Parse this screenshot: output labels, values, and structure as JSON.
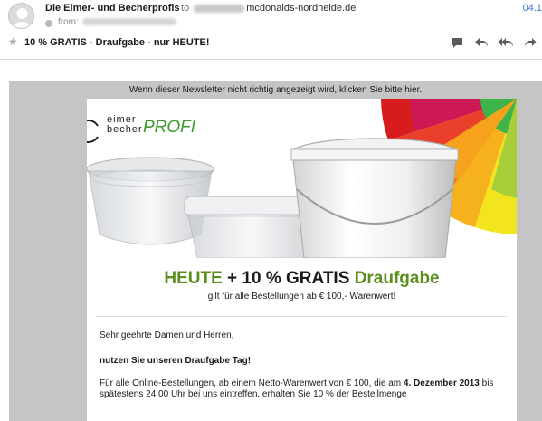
{
  "header": {
    "sender": "Die Eimer- und Becherprofis",
    "to_prefix": "to",
    "to_domain": "mcdonalds-nordheide.de",
    "date": "04.1",
    "from_label": "from:",
    "subject": "10 % GRATIS - Draufgabe - nur HEUTE!",
    "toolbar": [
      "comment-icon",
      "reply-icon",
      "reply-all-icon",
      "forward-icon"
    ]
  },
  "newsletter": {
    "notice": "Wenn dieser Newsletter nicht richtig angezeigt wird, klicken Sie bitte hier.",
    "logo_top": "eimer",
    "logo_bottom": "becher",
    "logo_profi": "PROFI",
    "headline": {
      "part1": "HEUTE",
      "part2": " + 10 % GRATIS ",
      "part3": "Draufgabe"
    },
    "subline": "gilt für alle Bestellungen ab € 100,- Warenwert!",
    "salutation": "Sehr geehrte Damen und Herren,",
    "intro": "nutzen Sie unseren Draufgabe Tag!",
    "para_a": "Für alle Online-Bestellungen, ab einem Netto-Warenwert von € 100, die am ",
    "para_date": "4. Dezember 2013",
    "para_b": " bis spätestens 24:00 Uhr bei uns eintreffen, erhalten Sie 10 % der Bestellmenge"
  },
  "colors": {
    "accent_green": "#5a8f1e",
    "link_blue": "#3a77d0",
    "frame_gray": "#c5c5c5"
  }
}
